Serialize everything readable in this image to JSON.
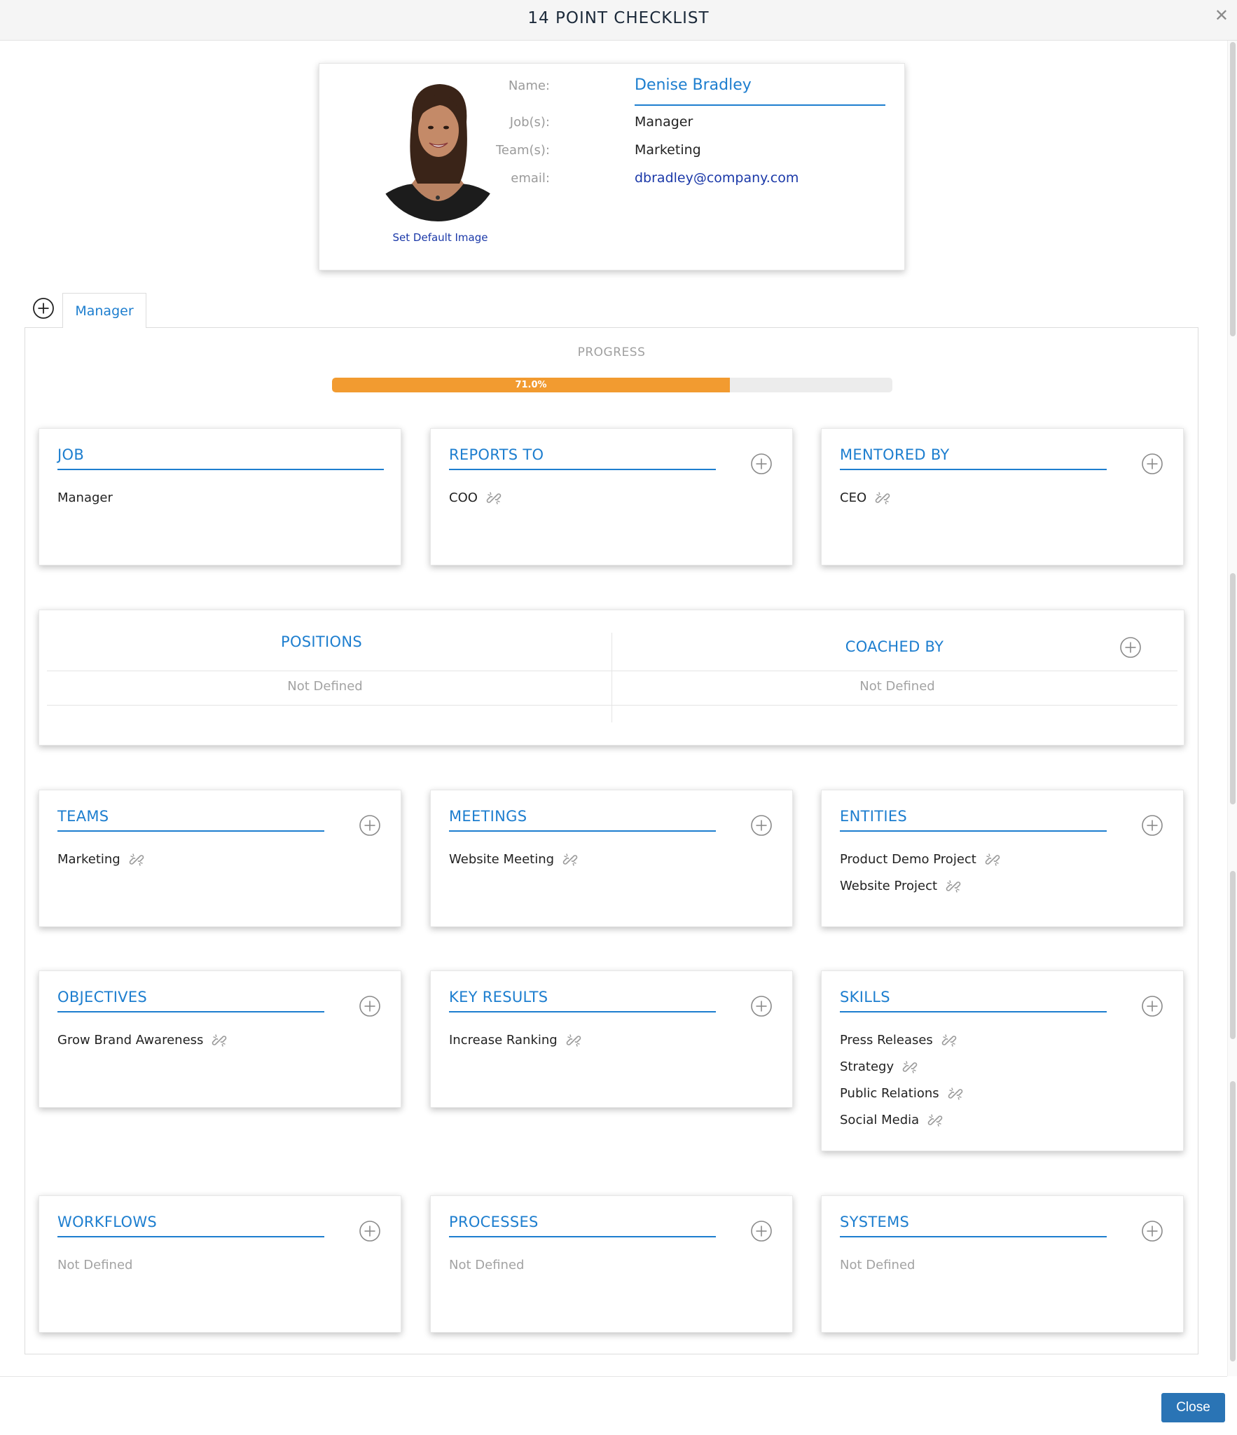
{
  "header": {
    "title": "14 POINT CHECKLIST",
    "close_icon": "close-icon"
  },
  "profile": {
    "name_label": "Name:",
    "name": "Denise Bradley",
    "jobs_label": "Job(s):",
    "jobs": "Manager",
    "teams_label": "Team(s):",
    "teams": "Marketing",
    "email_label": "email:",
    "email": "dbradley@company.com",
    "set_default_image": "Set Default Image"
  },
  "tabs": {
    "items": [
      {
        "label": "Manager"
      }
    ],
    "add_icon": "plus-circle-icon"
  },
  "progress": {
    "title": "PROGRESS",
    "value_text": "71.0%",
    "value": 71.0
  },
  "cards": {
    "job": {
      "title": "JOB",
      "items": [
        "Manager"
      ]
    },
    "reports_to": {
      "title": "REPORTS TO",
      "items": [
        "COO"
      ]
    },
    "mentored_by": {
      "title": "MENTORED BY",
      "items": [
        "CEO"
      ]
    },
    "teams": {
      "title": "TEAMS",
      "items": [
        "Marketing"
      ]
    },
    "meetings": {
      "title": "MEETINGS",
      "items": [
        "Website Meeting"
      ]
    },
    "entities": {
      "title": "ENTITIES",
      "items": [
        "Product Demo Project",
        "Website Project"
      ]
    },
    "objectives": {
      "title": "OBJECTIVES",
      "items": [
        "Grow Brand Awareness"
      ]
    },
    "key_results": {
      "title": "KEY RESULTS",
      "items": [
        "Increase Ranking"
      ]
    },
    "skills": {
      "title": "SKILLS",
      "items": [
        "Press Releases",
        "Strategy",
        "Public Relations",
        "Social Media"
      ]
    },
    "workflows": {
      "title": "WORKFLOWS",
      "empty": "Not Defined"
    },
    "processes": {
      "title": "PROCESSES",
      "empty": "Not Defined"
    },
    "systems": {
      "title": "SYSTEMS",
      "empty": "Not Defined"
    }
  },
  "wide": {
    "positions": {
      "title": "POSITIONS",
      "empty": "Not Defined"
    },
    "coached_by": {
      "title": "COACHED BY",
      "empty": "Not Defined"
    }
  },
  "footer": {
    "close_label": "Close"
  },
  "colors": {
    "accent": "#1d7ecf",
    "progress": "#f29b30",
    "button": "#2a74b5",
    "link": "#1a38a8"
  }
}
